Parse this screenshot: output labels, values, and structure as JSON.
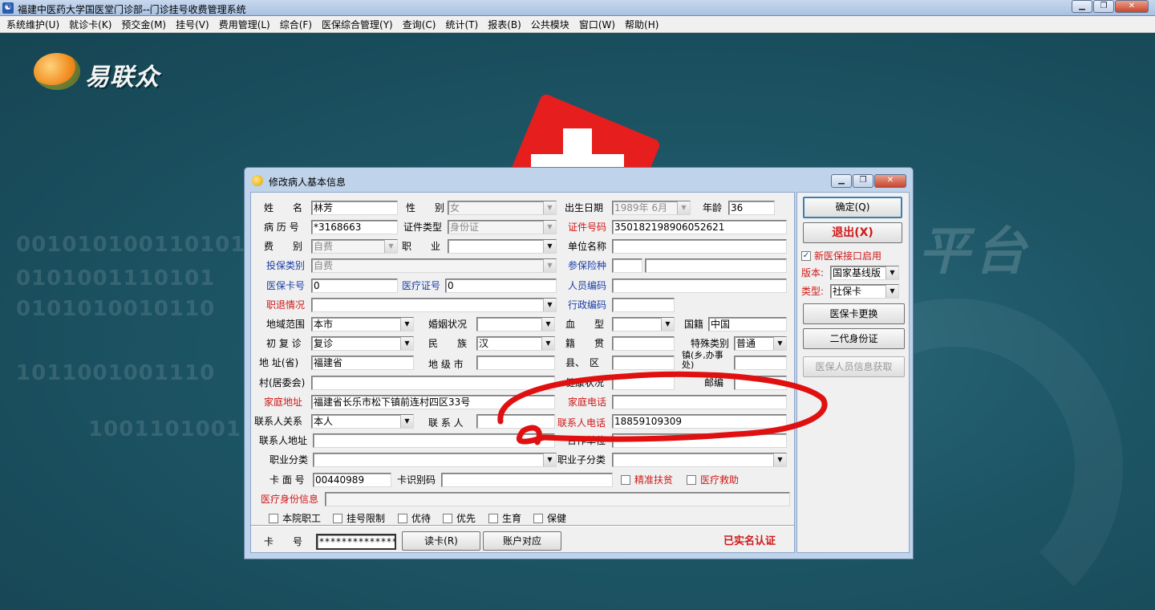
{
  "app": {
    "title": "福建中医药大学国医堂门诊部--门诊挂号收费管理系统",
    "title_icon": "app-icon"
  },
  "menubar": [
    "系统维护(U)",
    "就诊卡(K)",
    "预交金(M)",
    "挂号(V)",
    "费用管理(L)",
    "综合(F)",
    "医保综合管理(Y)",
    "查询(C)",
    "统计(T)",
    "报表(B)",
    "公共模块",
    "窗口(W)",
    "帮助(H)"
  ],
  "desktop": {
    "logo_text": "易联众",
    "watermark_text": "平台",
    "binary_text": [
      "0010101001101010",
      "0101001110101",
      "0101010010110",
      "1011001001110",
      "1001101001"
    ]
  },
  "dialog": {
    "title": "修改病人基本信息",
    "labels": {
      "name": "姓　　名",
      "gender": "性　　别",
      "birth": "出生日期",
      "age": "年龄",
      "record": "病 历 号",
      "id_type": "证件类型",
      "id_no": "证件号码",
      "fee": "费　　别",
      "job": "职　　业",
      "unit": "单位名称",
      "ins_type": "投保类别",
      "ins_kind": "参保险种",
      "ins_card": "医保卡号",
      "med_cert": "医疗证号",
      "staff_code": "人员编码",
      "retire": "职退情况",
      "admin_code": "行政编码",
      "region": "地域范围",
      "marital": "婚姻状况",
      "blood": "血　　型",
      "nation": "国籍",
      "visit": "初 复 诊",
      "ethnic": "民　　族",
      "origin": "籍　　贯",
      "special": "特殊类别",
      "province": "地 址(省)",
      "city": "地 级 市",
      "county": "县、　区",
      "town": "镇(乡,办事处)",
      "village": "村(居委会)",
      "health": "健康状况",
      "postcode": "邮编",
      "home_addr": "家庭地址",
      "home_tel": "家庭电话",
      "contact_rel": "联系人关系",
      "contact": "联 系 人",
      "contact_tel": "联系人电话",
      "contact_addr": "联系人地址",
      "coop_unit": "合作单位",
      "job_class": "职业分类",
      "job_subclass": "职业子分类",
      "card_face": "卡 面 号",
      "card_id": "卡识别码",
      "med_identity": "医疗身份信息",
      "card_no": "卡　　号"
    },
    "values": {
      "name": "林芳",
      "gender": "女",
      "birth": "1989年 6月",
      "age": "36",
      "record": "*3168663",
      "id_type": "身份证",
      "id_no": "350182198906052621",
      "fee": "自费",
      "job": "",
      "unit": "",
      "ins_type": "自费",
      "ins_kind_a": "",
      "ins_kind_b": "",
      "ins_card": "0",
      "med_cert": "0",
      "staff_code": "",
      "retire": "",
      "admin_code": "",
      "region": "本市",
      "marital": "",
      "blood": "",
      "nation": "中国",
      "visit": "复诊",
      "ethnic": "汉",
      "origin": "",
      "special": "普通",
      "province": "福建省",
      "city": "",
      "county": "",
      "town": "",
      "village": "",
      "health": "",
      "postcode": "",
      "home_addr": "福建省长乐市松下镇前连村四区33号",
      "home_tel": "",
      "contact_rel": "本人",
      "contact": "",
      "contact_tel": "18859109309",
      "contact_addr": "",
      "coop_unit": "",
      "job_class": "",
      "job_subclass": "",
      "card_face": "00440989",
      "card_id": "",
      "med_identity": "",
      "card_no": "**************"
    },
    "checkboxes_inline": [
      {
        "label": "精准扶贫",
        "checked": false
      },
      {
        "label": "医疗救助",
        "checked": false
      }
    ],
    "checkboxes_bottom": [
      {
        "label": "本院职工",
        "checked": false
      },
      {
        "label": "挂号限制",
        "checked": false
      },
      {
        "label": "优待",
        "checked": false
      },
      {
        "label": "优先",
        "checked": false
      },
      {
        "label": "生育",
        "checked": false
      },
      {
        "label": "保健",
        "checked": false
      }
    ],
    "buttons": {
      "read_card": "读卡(R)",
      "account_match": "账户对应"
    },
    "realname_status": "已实名认证",
    "side": {
      "ok": "确定(Q)",
      "exit": "退出(X)",
      "new_ins_iface": "新医保接口启用",
      "new_ins_iface_checked": true,
      "version_label": "版本:",
      "version_value": "国家基线版",
      "type_label": "类型:",
      "type_value": "社保卡",
      "change_card": "医保卡更换",
      "id_card2": "二代身份证",
      "get_ins_info": "医保人员信息获取"
    }
  },
  "colors": {
    "accent_red": "#d01818",
    "label_blue": "#1b3ea6",
    "annotation": "#e01010"
  }
}
